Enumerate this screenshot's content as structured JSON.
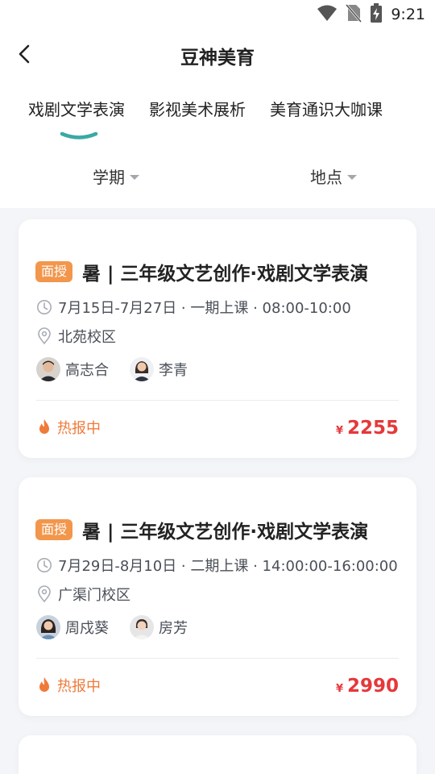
{
  "status": {
    "time": "9:21"
  },
  "header": {
    "title": "豆神美育"
  },
  "tabs": [
    {
      "label": "戏剧文学表演",
      "active": true
    },
    {
      "label": "影视美术展析",
      "active": false
    },
    {
      "label": "美育通识大咖课",
      "active": false
    }
  ],
  "filters": [
    {
      "label": "学期"
    },
    {
      "label": "地点"
    }
  ],
  "colors": {
    "accent": "#3aa9a4",
    "badge": "#f2964c",
    "hot": "#f07a3a",
    "price": "#e6383a"
  },
  "courses": [
    {
      "badge": "面授",
      "title": "暑 | 三年级文艺创作·戏剧文学表演",
      "schedule": "7月15日-7月27日 · 一期上课 · 08:00-10:00",
      "location": "北苑校区",
      "teachers": [
        {
          "name": "高志合"
        },
        {
          "name": "李青"
        }
      ],
      "status": "热报中",
      "currency": "¥",
      "price": "2255"
    },
    {
      "badge": "面授",
      "title": "暑 | 三年级文艺创作·戏剧文学表演",
      "schedule": "7月29日-8月10日 · 二期上课 · 14:00:00-16:00:00",
      "location": "广渠门校区",
      "teachers": [
        {
          "name": "周戍葵"
        },
        {
          "name": "房芳"
        }
      ],
      "status": "热报中",
      "currency": "¥",
      "price": "2990"
    }
  ]
}
